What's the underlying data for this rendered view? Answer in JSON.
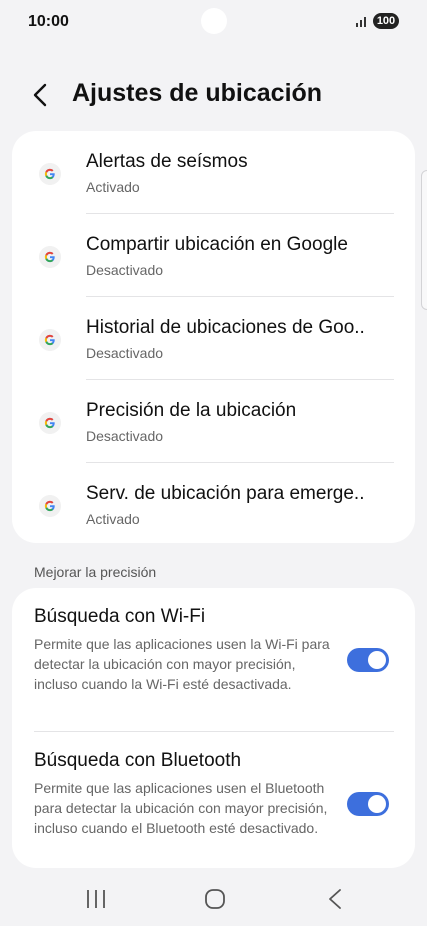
{
  "status_bar": {
    "time": "10:00",
    "battery": "100",
    "signal_icon": "signal-bars-icon"
  },
  "header": {
    "back_icon": "chevron-left-icon",
    "title": "Ajustes de ubicación"
  },
  "google_services": [
    {
      "title": "Alertas de seísmos",
      "status": "Activado",
      "icon": "google-g-icon"
    },
    {
      "title": "Compartir ubicación en Google",
      "status": "Desactivado",
      "icon": "google-g-icon"
    },
    {
      "title": "Historial de ubicaciones de Goo..",
      "status": "Desactivado",
      "icon": "google-g-icon"
    },
    {
      "title": "Precisión de la ubicación",
      "status": "Desactivado",
      "icon": "google-g-icon"
    },
    {
      "title": "Serv. de ubicación para emerge..",
      "status": "Activado",
      "icon": "google-g-icon"
    }
  ],
  "precision_section": {
    "header": "Mejorar la precisión",
    "items": [
      {
        "title": "Búsqueda con Wi-Fi",
        "description": "Permite que las aplicaciones usen la Wi-Fi para detectar la ubicación con mayor precisión, incluso cuando la Wi-Fi esté desactivada.",
        "enabled": true
      },
      {
        "title": "Búsqueda con Bluetooth",
        "description": "Permite que las aplicaciones usen el Bluetooth para detectar la ubicación con mayor precisión, incluso cuando el Bluetooth esté desactivado.",
        "enabled": true
      }
    ]
  },
  "nav_bar": {
    "recents_icon": "recents-icon",
    "home_icon": "home-icon",
    "back_icon": "back-icon"
  },
  "colors": {
    "accent": "#3d6fdd",
    "background": "#f3f3f5",
    "card": "#ffffff",
    "secondary_text": "#666666"
  }
}
